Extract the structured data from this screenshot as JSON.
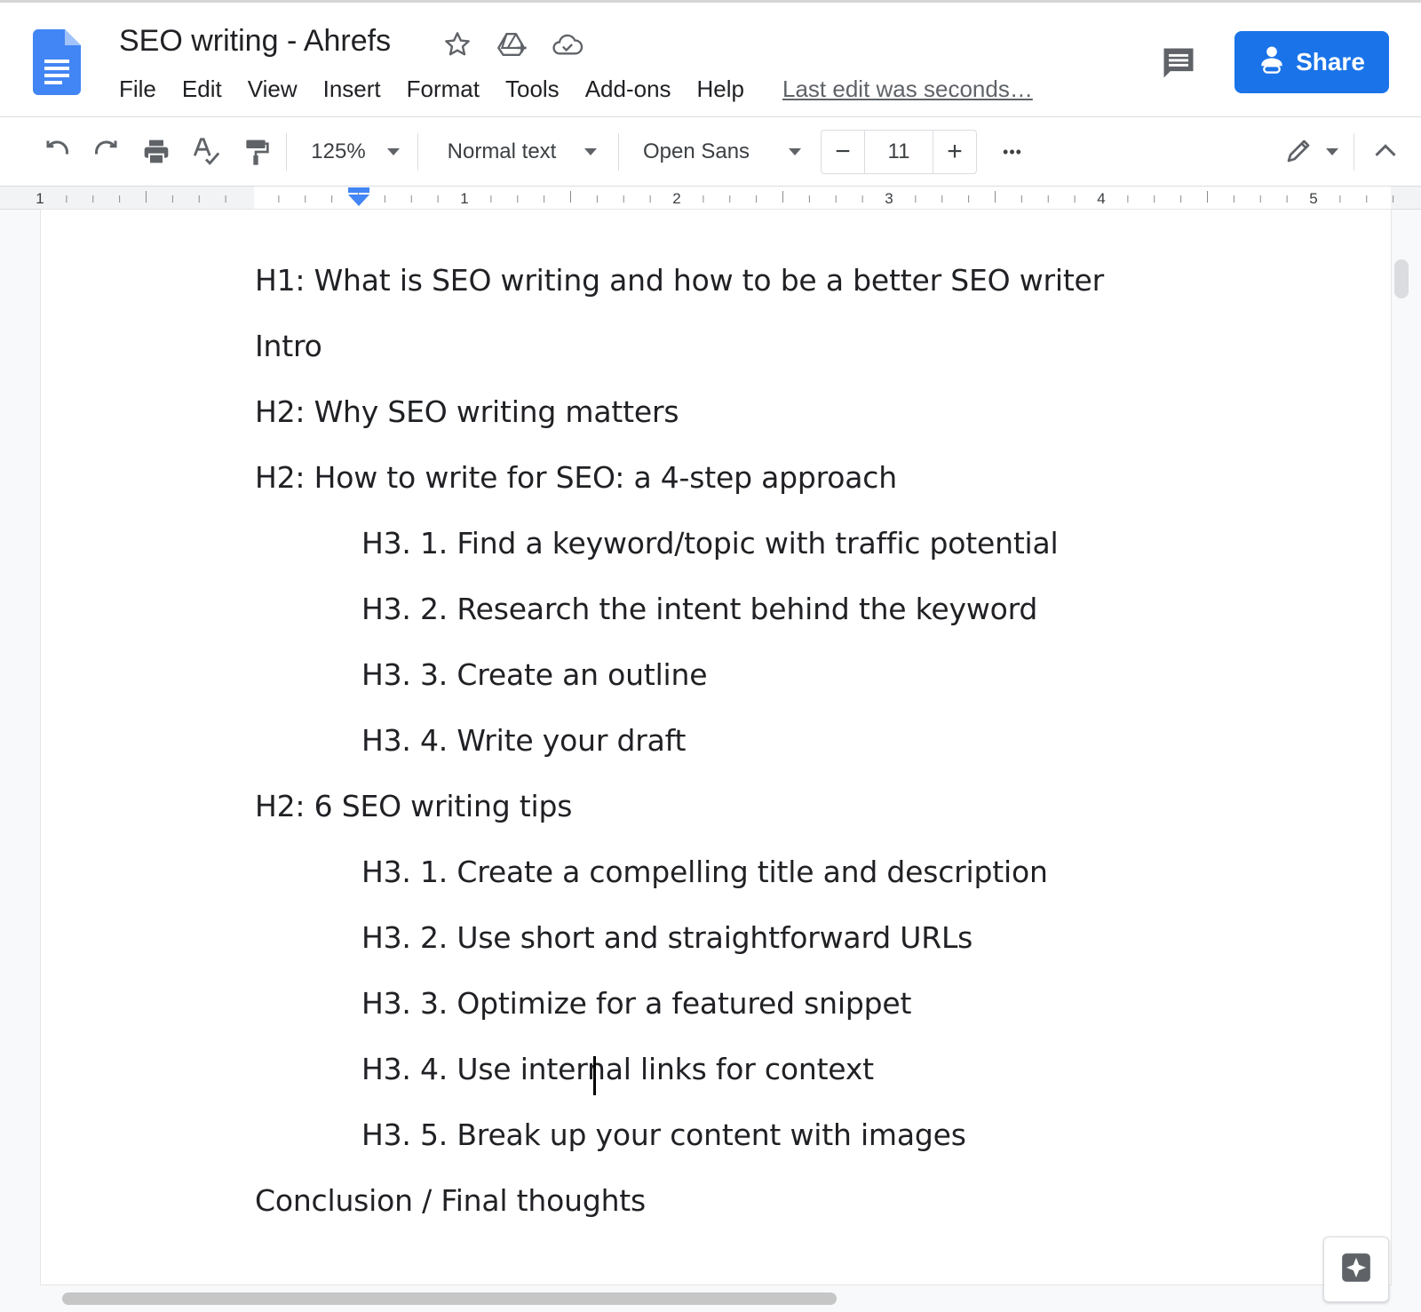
{
  "window": {
    "title": "SEO writing - Ahrefs",
    "last_edit": "Last edit was seconds…",
    "share_label": "Share",
    "accent_color": "#1a73e8"
  },
  "menu": [
    "File",
    "Edit",
    "View",
    "Insert",
    "Format",
    "Tools",
    "Add-ons",
    "Help"
  ],
  "title_icons": [
    "star-icon",
    "move-to-drive-icon",
    "cloud-saved-icon"
  ],
  "toolbar": {
    "zoom": "125%",
    "style": "Normal text",
    "font": "Open Sans",
    "font_size": "11",
    "minus": "−",
    "plus": "+",
    "more": "•••"
  },
  "ruler": {
    "numbers": [
      "1",
      "1",
      "2",
      "3",
      "4",
      "5"
    ]
  },
  "document": {
    "lines": [
      "H1: What is SEO writing and how to be a better SEO writer",
      "Intro",
      "H2: Why SEO writing matters",
      "H2: How to write for SEO: a 4-step approach",
      "H3. 1. Find a keyword/topic with traffic potential",
      "H3. 2. Research the intent behind the keyword",
      "H3. 3. Create an outline",
      "H3. 4. Write your draft",
      "H2: 6 SEO writing tips",
      "H3. 1. Create a compelling title and description",
      "H3. 2. Use short and straightforward URLs",
      "H3. 3. Optimize for a featured snippet",
      "H3. 4. Use internal links for context",
      "H3. 5. Break up your content with images",
      "Conclusion / Final thoughts"
    ]
  }
}
